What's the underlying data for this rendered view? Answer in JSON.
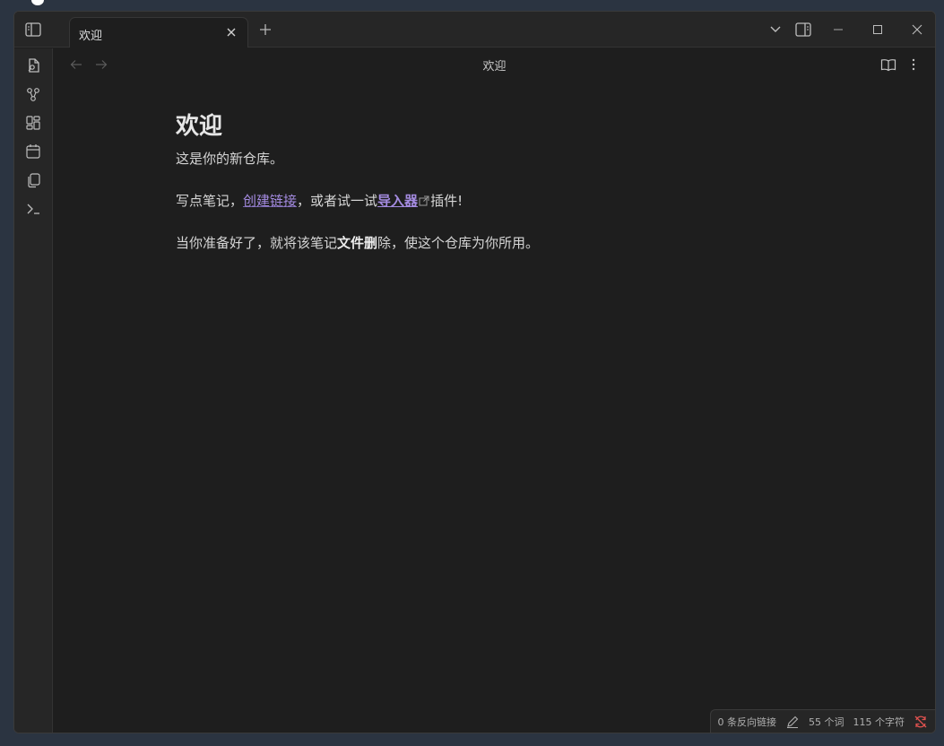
{
  "tab": {
    "label": "欢迎"
  },
  "view": {
    "title": "欢迎"
  },
  "note": {
    "heading": "欢迎",
    "para1": "这是你的新仓库。",
    "para2": {
      "prefix": "写点笔记，",
      "link_internal": "创建链接",
      "middle": "，或者试一试",
      "link_external": "导入器",
      "suffix": "插件!"
    },
    "para3": {
      "prefix": "当你准备好了，就将该笔记",
      "bold": "文件删",
      "suffix": "除，使这个仓库为你所用。"
    }
  },
  "statusbar": {
    "backlinks": "0 条反向链接",
    "words": "55 个词",
    "chars": "115 个字符"
  },
  "colors": {
    "accent": "#a48be0",
    "sync_error": "#e0524f"
  },
  "icons": [
    "sidebar-toggle-icon",
    "close-icon",
    "plus-icon",
    "chevron-down-icon",
    "right-sidebar-icon",
    "minimize-icon",
    "maximize-icon",
    "window-close-icon",
    "quick-switcher-icon",
    "graph-icon",
    "canvas-icon",
    "calendar-icon",
    "templates-icon",
    "terminal-icon",
    "arrow-left-icon",
    "arrow-right-icon",
    "reading-view-icon",
    "more-options-icon",
    "external-link-icon",
    "pencil-icon",
    "sync-error-icon"
  ]
}
